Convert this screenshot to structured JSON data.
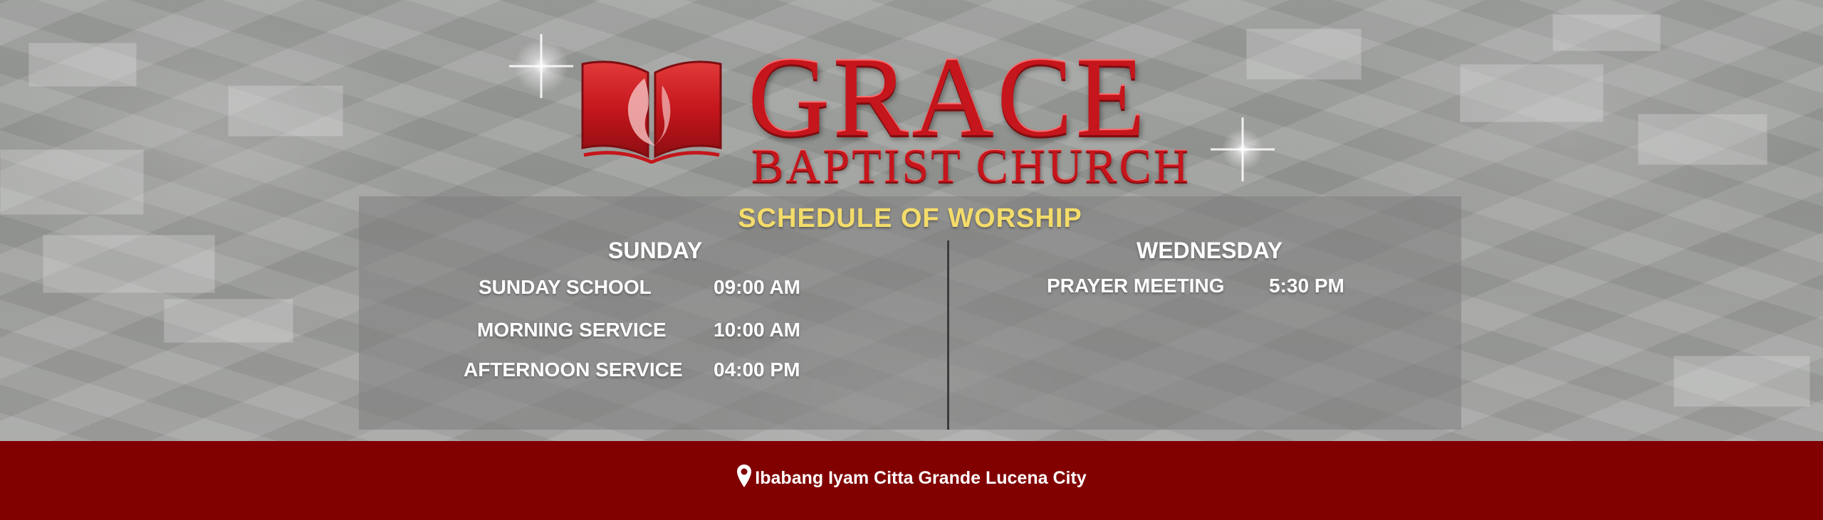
{
  "logo": {
    "title": "GRACE",
    "subtitle": "BAPTIST CHURCH",
    "brand_color": "#c4161c"
  },
  "schedule": {
    "title": "SCHEDULE OF WORSHIP",
    "title_color": "#f4dc6a",
    "sunday": {
      "day": "SUNDAY",
      "items": [
        {
          "label": "SUNDAY SCHOOL",
          "time": "09:00 AM"
        },
        {
          "label": "MORNING SERVICE",
          "time": "10:00 AM"
        },
        {
          "label": "AFTERNOON SERVICE",
          "time": "04:00 PM"
        }
      ]
    },
    "wednesday": {
      "day": "WEDNESDAY",
      "items": [
        {
          "label": "PRAYER MEETING",
          "time": "5:30 PM"
        }
      ]
    }
  },
  "footer": {
    "address": "Ibabang Iyam Citta Grande Lucena City",
    "icon": "map-pin-icon",
    "background_color": "#810000"
  }
}
